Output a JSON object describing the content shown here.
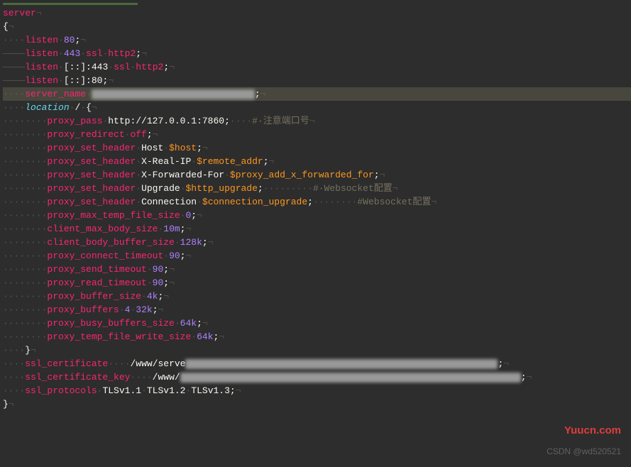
{
  "code": {
    "server": "server",
    "brace_open": "{",
    "brace_close": "}",
    "semicolon": ";",
    "dots4": "····",
    "dash4": "————",
    "dots8": "········",
    "nl": "¬",
    "listen": "listen",
    "port80": "80",
    "port443": "443",
    "ssl": "ssl",
    "http2": "http2",
    "ipv6_443": "[::]:443",
    "ipv6_80": "[::]:80",
    "server_name": "server_name",
    "location": "location",
    "slash": "/",
    "proxy_pass": "proxy_pass",
    "proxy_pass_url": "http://127.0.0.1:7860",
    "comment_port": "#·注意端口号",
    "proxy_redirect": "proxy_redirect",
    "off": "off",
    "proxy_set_header": "proxy_set_header",
    "host": "Host",
    "host_var": "$host",
    "xrealip": "X-Real-IP",
    "remote_addr": "$remote_addr",
    "xff": "X-Forwarded-For",
    "xff_var": "$proxy_add_x_forwarded_for",
    "upgrade": "Upgrade",
    "http_upgrade": "$http_upgrade",
    "comment_ws1": "#·Websocket配置",
    "connection": "Connection",
    "conn_upgrade": "$connection_upgrade",
    "comment_ws2": "#Websocket配置",
    "proxy_max_temp_file_size": "proxy_max_temp_file_size",
    "zero": "0",
    "client_max_body_size": "client_max_body_size",
    "ten_m": "10m",
    "client_body_buffer_size": "client_body_buffer_size",
    "k128": "128k",
    "proxy_connect_timeout": "proxy_connect_timeout",
    "ninety": "90",
    "proxy_send_timeout": "proxy_send_timeout",
    "proxy_read_timeout": "proxy_read_timeout",
    "proxy_buffer_size": "proxy_buffer_size",
    "fourk": "4k",
    "proxy_buffers": "proxy_buffers",
    "four": "4",
    "k32": "32k",
    "proxy_busy_buffers_size": "proxy_busy_buffers_size",
    "k64": "64k",
    "proxy_temp_file_write_size": "proxy_temp_file_write_size",
    "ssl_certificate": "ssl_certificate",
    "cert_path": "/www/serve",
    "ssl_certificate_key": "ssl_certificate_key",
    "key_path": "/www/",
    "ssl_protocols": "ssl_protocols",
    "tls11": "TLSv1.1",
    "tls12": "TLSv1.2",
    "tls13": "TLSv1.3"
  },
  "watermarks": {
    "site": "Yuucn.com",
    "csdn": "CSDN @wd520521"
  }
}
